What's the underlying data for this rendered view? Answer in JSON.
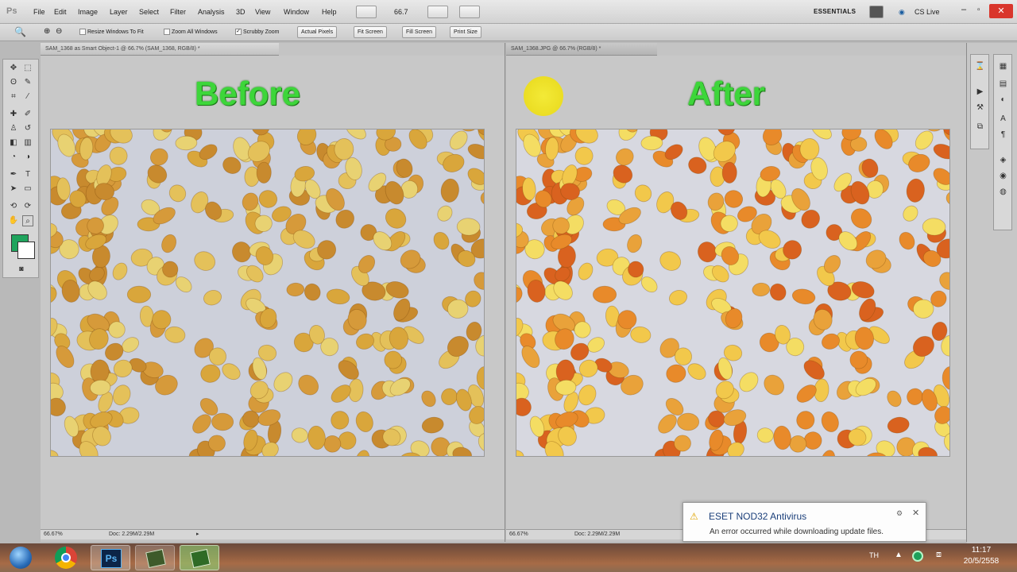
{
  "app": {
    "logo": "Ps"
  },
  "menu": [
    "File",
    "Edit",
    "Image",
    "Layer",
    "Select",
    "Filter",
    "Analysis",
    "3D",
    "View",
    "Window",
    "Help"
  ],
  "toolbar_top": {
    "zoom_value": "66.7",
    "workspace": "ESSENTIALS",
    "cs_live": "CS Live"
  },
  "options": {
    "resize_windows": "Resize Windows To Fit",
    "zoom_all": "Zoom All Windows",
    "scrubby": "Scrubby Zoom",
    "buttons": [
      "Actual Pixels",
      "Fit Screen",
      "Fill Screen",
      "Print Size"
    ]
  },
  "documents": [
    {
      "tab": "SAM_1368 as Smart Object-1 @ 66.7% (SAM_1368, RGB/8) *",
      "heading": "Before",
      "zoom": "66.67%",
      "doc_info": "Doc: 2.29M/2.29M"
    },
    {
      "tab": "SAM_1368.JPG @ 66.7% (RGB/8) *",
      "heading": "After",
      "zoom": "66.67%",
      "doc_info": "Doc: 2.29M/2.29M"
    }
  ],
  "notification": {
    "title": "ESET NOD32 Antivirus",
    "message": "An error occurred while downloading update files."
  },
  "tray": {
    "lang": "TH",
    "time": "11:17",
    "date": "20/5/2558"
  },
  "colors": {
    "foreground": "#1fa45d",
    "background": "#ffffff",
    "heading_green": "#3dd63a"
  }
}
